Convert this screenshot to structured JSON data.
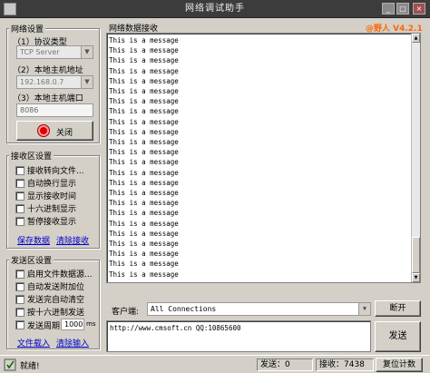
{
  "window": {
    "title": "网络调试助手"
  },
  "net_settings": {
    "group_label": "网络设置",
    "protocol_label": "（1）协议类型",
    "protocol_value": "TCP Server",
    "host_label": "（2）本地主机地址",
    "host_value": "192.168.0.7",
    "port_label": "（3）本地主机端口",
    "port_value": "8086",
    "close_button": "关闭"
  },
  "recv_settings": {
    "group_label": "接收区设置",
    "options": [
      "接收转向文件...",
      "自动换行显示",
      "显示接收时间",
      "十六进制显示",
      "暂停接收显示"
    ],
    "save_link": "保存数据",
    "clear_link": "清除接收"
  },
  "send_settings": {
    "group_label": "发送区设置",
    "options": [
      "启用文件数据源...",
      "自动发送附加位",
      "发送完自动清空",
      "按十六进制发送"
    ],
    "cycle_label": "发送周期",
    "cycle_value": "1000",
    "cycle_unit": "ms",
    "load_link": "文件载入",
    "clear_link": "清除输入"
  },
  "receive_area": {
    "label": "网络数据接收",
    "version": "@野人 V4.2.1",
    "messages": [
      "This is a message",
      "This is a message",
      "This is a message",
      "This is a message",
      "This is a message",
      "This is a message",
      "This is a message",
      "This is a message",
      "This is a message",
      "This is a message",
      "This is a message",
      "This is a message",
      "This is a message",
      "This is a message",
      "This is a message",
      "This is a message",
      "This is a message",
      "This is a message",
      "This is a message",
      "This is a message",
      "This is a message",
      "This is a message",
      "This is a message",
      "This is a message",
      "This is a message",
      "This is a message",
      "This is a message",
      "This is a message",
      "This is a message",
      "This is a message",
      "This is a message",
      "This is a message",
      "This is a message",
      "This is a message",
      "This is a message",
      "This is a message",
      "This is a message",
      "This is a message",
      "This is a message",
      "This is a message",
      "This is a message",
      "This is a message",
      "This is a message",
      "This is a message",
      "This is a message",
      "This is a message",
      "This is a message",
      "This is a message",
      "This is a message",
      "This is a message",
      "This is a message",
      "This is a message",
      "This is a message",
      "This is a message",
      "This is a message",
      "This is a message",
      "This is a message",
      "This is a message",
      "This is a message",
      "This is a message",
      "This is a message",
      "This is a message",
      "This is a message",
      "This is a message",
      "This is a message",
      "This is a message",
      "This is a message",
      "This is a message",
      "This is a message",
      "This is a message",
      "This is a message",
      "This is a message",
      "This is a message",
      "This is a message",
      "This is a message",
      "This is a message",
      "This is a message",
      "This is a message",
      "This is a message",
      "This is a message",
      "This is a message",
      "This is a message",
      "This is a message",
      "This is a message",
      "This is a message",
      "This is a message",
      "This is a message",
      "This is a message",
      "This is a message",
      "This is a message",
      "This is a message",
      "This is a message",
      "This is a message",
      "This is a message",
      "This is a message",
      "This is a message",
      "This is a message",
      "This is a message",
      "This is a message",
      "This is a message",
      "This is a message",
      "This is a message",
      "This is a message",
      "This is a message",
      "This is a message",
      "This is a message",
      "This is a message",
      "This is a message",
      "This is a message",
      "This is a message",
      "This is a message",
      "This is a message",
      "This is a message",
      "This is a message"
    ]
  },
  "client": {
    "label": "客户端:",
    "value": "All Connections",
    "disconnect_button": "断开"
  },
  "send_area": {
    "text": "http://www.cmsoft.cn QQ:10865600",
    "send_button": "发送"
  },
  "status_bar": {
    "ready": "就绪!",
    "sent_label": "发送：0",
    "recv_label": "接收：7438",
    "reset_button": "复位计数"
  },
  "colors": {
    "title_bar": "#3c3c3c",
    "version": "#ff6600",
    "link": "#0000cc",
    "close_icon": "#dd0000"
  }
}
